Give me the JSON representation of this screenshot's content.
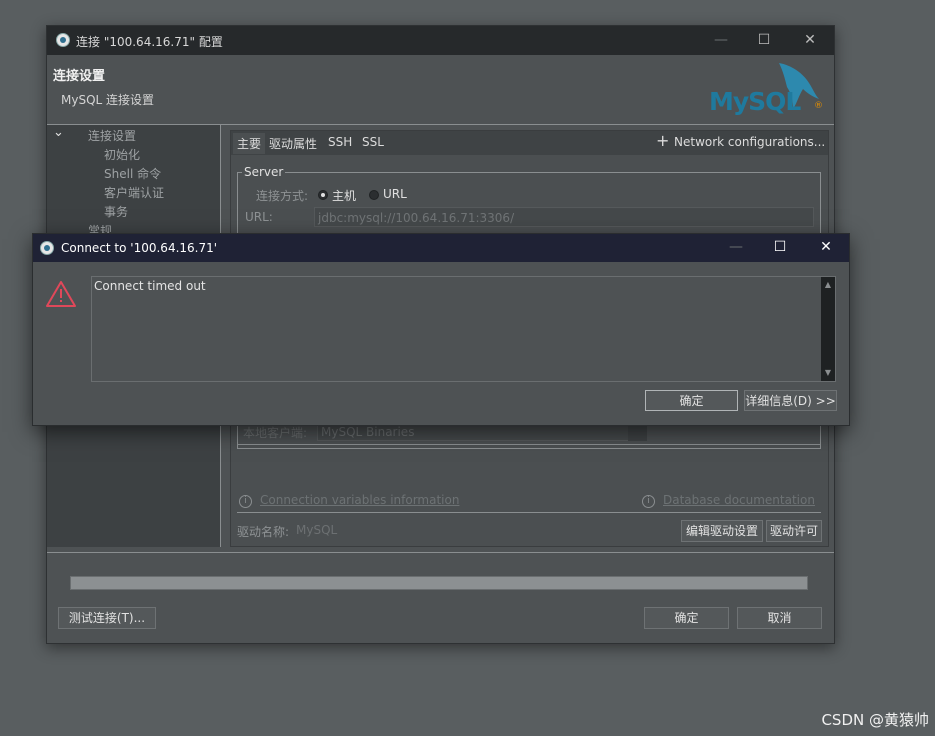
{
  "main_window": {
    "title": "连接 \"100.64.16.71\" 配置",
    "controls": {
      "minimize": "—",
      "maximize": "☐",
      "close": "✕"
    },
    "header": {
      "title": "连接设置",
      "subtitle": "MySQL 连接设置",
      "logo_text": "MySQL",
      "logo_mark": "®"
    },
    "nav_tree": {
      "expander": "⌄",
      "items": [
        {
          "label": "连接设置"
        },
        {
          "label": "初始化"
        },
        {
          "label": "Shell 命令"
        },
        {
          "label": "客户端认证"
        },
        {
          "label": "事务"
        },
        {
          "label": "常规"
        }
      ]
    },
    "tabs": [
      {
        "label": "主要",
        "active": true
      },
      {
        "label": "驱动属性"
      },
      {
        "label": "SSH"
      },
      {
        "label": "SSL"
      }
    ],
    "network_config": {
      "icon": "+",
      "label": "Network configurations..."
    },
    "server_group": {
      "legend": "Server",
      "connect_method_label": "连接方式:",
      "options": [
        {
          "label": "主机",
          "selected": true
        },
        {
          "label": "URL",
          "selected": false
        }
      ],
      "url_label": "URL:",
      "url_value": "jdbc:mysql://100.64.16.71:3306/"
    },
    "local_client": {
      "label": "本地客户端:",
      "value": "MySQL Binaries"
    },
    "links": {
      "info_glyph": "i",
      "connection_vars": "Connection variables information",
      "database_docs": "Database documentation"
    },
    "driver": {
      "label": "驱动名称:",
      "value": "MySQL",
      "edit_button": "编辑驱动设置",
      "license_button": "驱动许可"
    },
    "progress": 1.0,
    "footer": {
      "test_button": "测试连接(T)...",
      "ok_button": "确定",
      "cancel_button": "取消"
    }
  },
  "dialog": {
    "title": "Connect to '100.64.16.71'",
    "controls": {
      "minimize": "—",
      "maximize": "☐",
      "close": "✕"
    },
    "message": "Connect timed out",
    "scroll_up": "▲",
    "scroll_down": "▼",
    "ok_button": "确定",
    "details_button": "详细信息(D) >>"
  },
  "watermark": "CSDN @黄猿帅",
  "colors": {
    "warning_red": "#e0485a",
    "mysql_blue": "#1f7a9e",
    "mysql_orange": "#e48e00"
  }
}
